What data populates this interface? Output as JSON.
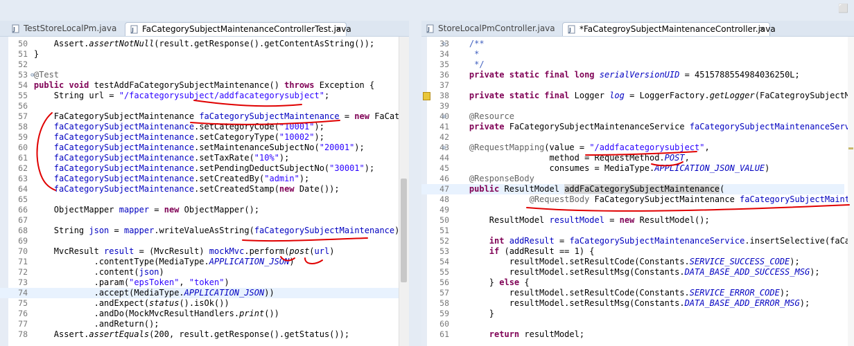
{
  "window": {
    "maximize_glyph": "⬜"
  },
  "left": {
    "tabs": [
      {
        "label": "TestStoreLocalPm.java",
        "active": false
      },
      {
        "label": "FaCategorySubjectMaintenanceControllerTest.java",
        "active": true,
        "close": "✕"
      }
    ],
    "lines": [
      {
        "n": "50",
        "t": [
          [
            "        Assert.",
            ""
          ],
          [
            "assertNotNull",
            "it"
          ],
          [
            "(result.getResponse().getContentAsString());",
            ""
          ]
        ]
      },
      {
        "n": "51",
        "t": [
          [
            "    }",
            ""
          ]
        ]
      },
      {
        "n": "52",
        "t": []
      },
      {
        "n": "53",
        "fold": "⊖",
        "t": [
          [
            "    @Test",
            "an"
          ]
        ]
      },
      {
        "n": "54",
        "t": [
          [
            "    ",
            ""
          ],
          [
            "public void",
            "kw"
          ],
          [
            " testAddFaCategorySubjectMaintenance() ",
            ""
          ],
          [
            "throws",
            "kw"
          ],
          [
            " Exception {",
            ""
          ]
        ]
      },
      {
        "n": "55",
        "t": [
          [
            "        String url = ",
            ""
          ],
          [
            "\"/facategorysubject/addfacategorysubject\"",
            "st"
          ],
          [
            ";",
            ""
          ]
        ]
      },
      {
        "n": "56",
        "t": []
      },
      {
        "n": "57",
        "t": [
          [
            "        FaCategorySubjectMaintenance ",
            ""
          ],
          [
            "faCategorySubjectMaintenance",
            "fn"
          ],
          [
            " = ",
            ""
          ],
          [
            "new",
            "kw"
          ],
          [
            " FaCategorySubjectMaintenance();",
            ""
          ]
        ]
      },
      {
        "n": "58",
        "t": [
          [
            "        ",
            ""
          ],
          [
            "faCategorySubjectMaintenance",
            "fn"
          ],
          [
            ".setCategoryCode(",
            ""
          ],
          [
            "\"10001\"",
            "st"
          ],
          [
            ");",
            ""
          ]
        ]
      },
      {
        "n": "59",
        "t": [
          [
            "        ",
            ""
          ],
          [
            "faCategorySubjectMaintenance",
            "fn"
          ],
          [
            ".setCategoryType(",
            ""
          ],
          [
            "\"10002\"",
            "st"
          ],
          [
            ");",
            ""
          ]
        ]
      },
      {
        "n": "60",
        "t": [
          [
            "        ",
            ""
          ],
          [
            "faCategorySubjectMaintenance",
            "fn"
          ],
          [
            ".setMaintenanceSubjectNo(",
            ""
          ],
          [
            "\"20001\"",
            "st"
          ],
          [
            ");",
            ""
          ]
        ]
      },
      {
        "n": "61",
        "t": [
          [
            "        ",
            ""
          ],
          [
            "faCategorySubjectMaintenance",
            "fn"
          ],
          [
            ".setTaxRate(",
            ""
          ],
          [
            "\"10%\"",
            "st"
          ],
          [
            ");",
            ""
          ]
        ]
      },
      {
        "n": "62",
        "t": [
          [
            "        ",
            ""
          ],
          [
            "faCategorySubjectMaintenance",
            "fn"
          ],
          [
            ".setPendingDeductSubjectNo(",
            ""
          ],
          [
            "\"30001\"",
            "st"
          ],
          [
            ");",
            ""
          ]
        ]
      },
      {
        "n": "63",
        "t": [
          [
            "        ",
            ""
          ],
          [
            "faCategorySubjectMaintenance",
            "fn"
          ],
          [
            ".setCreatedBy(",
            ""
          ],
          [
            "\"admin\"",
            "st"
          ],
          [
            ");",
            ""
          ]
        ]
      },
      {
        "n": "64",
        "t": [
          [
            "        ",
            ""
          ],
          [
            "faCategorySubjectMaintenance",
            "fn"
          ],
          [
            ".setCreatedStamp(",
            ""
          ],
          [
            "new",
            "kw"
          ],
          [
            " Date());",
            ""
          ]
        ]
      },
      {
        "n": "65",
        "t": []
      },
      {
        "n": "66",
        "t": [
          [
            "        ObjectMapper ",
            ""
          ],
          [
            "mapper",
            "fn"
          ],
          [
            " = ",
            ""
          ],
          [
            "new",
            "kw"
          ],
          [
            " ObjectMapper();",
            ""
          ]
        ]
      },
      {
        "n": "67",
        "t": []
      },
      {
        "n": "68",
        "t": [
          [
            "        String ",
            ""
          ],
          [
            "json",
            "fn"
          ],
          [
            " = ",
            ""
          ],
          [
            "mapper",
            "fn"
          ],
          [
            ".writeValueAsString(",
            ""
          ],
          [
            "faCategorySubjectMaintenance",
            "fn"
          ],
          [
            ");",
            ""
          ]
        ]
      },
      {
        "n": "69",
        "t": []
      },
      {
        "n": "70",
        "t": [
          [
            "        MvcResult ",
            ""
          ],
          [
            "result",
            "fn"
          ],
          [
            " = (MvcResult) ",
            ""
          ],
          [
            "mockMvc",
            "fn"
          ],
          [
            ".perform(",
            ""
          ],
          [
            "post",
            "it"
          ],
          [
            "(",
            ""
          ],
          [
            "url",
            "fn"
          ],
          [
            ")",
            ""
          ]
        ]
      },
      {
        "n": "71",
        "t": [
          [
            "                .contentType(MediaType.",
            ""
          ],
          [
            "APPLICATION_JSON",
            "fi"
          ],
          [
            ")",
            ""
          ]
        ]
      },
      {
        "n": "72",
        "t": [
          [
            "                .content(",
            ""
          ],
          [
            "json",
            "fn"
          ],
          [
            ")",
            ""
          ]
        ]
      },
      {
        "n": "73",
        "t": [
          [
            "                .param(",
            ""
          ],
          [
            "\"epsToken\"",
            "st"
          ],
          [
            ", ",
            ""
          ],
          [
            "\"token\"",
            "st"
          ],
          [
            ")",
            ""
          ]
        ]
      },
      {
        "n": "74",
        "hl": true,
        "t": [
          [
            "                .accept(MediaType.",
            ""
          ],
          [
            "APPLICATION_JSON",
            "fi"
          ],
          [
            "))",
            ""
          ]
        ]
      },
      {
        "n": "75",
        "t": [
          [
            "                .andExpect(",
            ""
          ],
          [
            "status",
            "it"
          ],
          [
            "().isOk())",
            ""
          ]
        ]
      },
      {
        "n": "76",
        "t": [
          [
            "                .andDo(MockMvcResultHandlers.",
            ""
          ],
          [
            "print",
            "it"
          ],
          [
            "())",
            ""
          ]
        ]
      },
      {
        "n": "77",
        "t": [
          [
            "                .andReturn();",
            ""
          ]
        ]
      },
      {
        "n": "78",
        "t": [
          [
            "        Assert.",
            ""
          ],
          [
            "assertEquals",
            "it"
          ],
          [
            "(200, result.getResponse().getStatus());",
            ""
          ]
        ]
      }
    ]
  },
  "right": {
    "tabs": [
      {
        "label": "StoreLocalPmController.java",
        "active": false
      },
      {
        "label": "*FaCategroySubjectMaintenanceController.java",
        "active": true,
        "close": "✕"
      }
    ],
    "lines": [
      {
        "n": "33",
        "fold": "⊖",
        "t": [
          [
            "    /**",
            "cm"
          ]
        ]
      },
      {
        "n": "34",
        "t": [
          [
            "     *",
            "cm"
          ]
        ]
      },
      {
        "n": "35",
        "t": [
          [
            "     */",
            "cm"
          ]
        ]
      },
      {
        "n": "36",
        "t": [
          [
            "    ",
            ""
          ],
          [
            "private static final long",
            "kw"
          ],
          [
            " ",
            ""
          ],
          [
            "serialVersionUID",
            "fi"
          ],
          [
            " = 4515788554984036250L;",
            ""
          ]
        ]
      },
      {
        "n": "37",
        "t": []
      },
      {
        "n": "38",
        "warn": true,
        "t": [
          [
            "    ",
            ""
          ],
          [
            "private static final",
            "kw"
          ],
          [
            " Logger ",
            ""
          ],
          [
            "log",
            "fi"
          ],
          [
            " = LoggerFactory.",
            ""
          ],
          [
            "getLogger",
            "it"
          ],
          [
            "(FaCategroySubjectMaintenanceController.class);",
            ""
          ]
        ]
      },
      {
        "n": "39",
        "t": []
      },
      {
        "n": "40",
        "fold": "⊖",
        "t": [
          [
            "    @Resource",
            "an"
          ]
        ]
      },
      {
        "n": "41",
        "t": [
          [
            "    ",
            ""
          ],
          [
            "private",
            "kw"
          ],
          [
            " FaCategorySubjectMaintenanceService ",
            ""
          ],
          [
            "faCategorySubjectMaintenanceService",
            "fn"
          ],
          [
            ";",
            ""
          ]
        ]
      },
      {
        "n": "42",
        "t": []
      },
      {
        "n": "43",
        "fold": "⊖",
        "t": [
          [
            "    @RequestMapping",
            "an"
          ],
          [
            "(value = ",
            ""
          ],
          [
            "\"/addfacategorysubject\"",
            "st"
          ],
          [
            ",",
            ""
          ]
        ]
      },
      {
        "n": "44",
        "t": [
          [
            "                    method = RequestMethod.",
            ""
          ],
          [
            "POST",
            "fi"
          ],
          [
            ",",
            ""
          ]
        ]
      },
      {
        "n": "45",
        "t": [
          [
            "                    consumes = MediaType.",
            ""
          ],
          [
            "APPLICATION_JSON_VALUE",
            "fi"
          ],
          [
            ")",
            ""
          ]
        ]
      },
      {
        "n": "46",
        "t": [
          [
            "    @ResponseBody",
            "an"
          ]
        ]
      },
      {
        "n": "47",
        "hl": true,
        "t": [
          [
            "    ",
            ""
          ],
          [
            "public",
            "kw"
          ],
          [
            " ResultModel ",
            ""
          ],
          [
            "addFaCategorySubjectMaintenance",
            "wordhl"
          ],
          [
            "(",
            ""
          ]
        ]
      },
      {
        "n": "48",
        "t": [
          [
            "                ",
            ""
          ],
          [
            "@RequestBody",
            "an"
          ],
          [
            " FaCategorySubjectMaintenance ",
            ""
          ],
          [
            "faCategorySubjectMaintenance",
            "fn"
          ],
          [
            ") {",
            ""
          ]
        ]
      },
      {
        "n": "49",
        "t": []
      },
      {
        "n": "50",
        "t": [
          [
            "        ResultModel ",
            ""
          ],
          [
            "resultModel",
            "fn"
          ],
          [
            " = ",
            ""
          ],
          [
            "new",
            "kw"
          ],
          [
            " ResultModel();",
            ""
          ]
        ]
      },
      {
        "n": "51",
        "t": []
      },
      {
        "n": "52",
        "t": [
          [
            "        ",
            ""
          ],
          [
            "int",
            "kw"
          ],
          [
            " ",
            ""
          ],
          [
            "addResult",
            "fn"
          ],
          [
            " = ",
            ""
          ],
          [
            "faCategorySubjectMaintenanceService",
            "fn"
          ],
          [
            ".insertSelective(faCategorySubjectMaintenance);",
            ""
          ]
        ]
      },
      {
        "n": "53",
        "t": [
          [
            "        ",
            ""
          ],
          [
            "if",
            "kw"
          ],
          [
            " (addResult == 1) {",
            ""
          ]
        ]
      },
      {
        "n": "54",
        "t": [
          [
            "            resultModel.setResultCode(Constants.",
            ""
          ],
          [
            "SERVICE_SUCCESS_CODE",
            "fi"
          ],
          [
            ");",
            ""
          ]
        ]
      },
      {
        "n": "55",
        "t": [
          [
            "            resultModel.setResultMsg(Constants.",
            ""
          ],
          [
            "DATA_BASE_ADD_SUCCESS_MSG",
            "fi"
          ],
          [
            ");",
            ""
          ]
        ]
      },
      {
        "n": "56",
        "t": [
          [
            "        } ",
            ""
          ],
          [
            "else",
            "kw"
          ],
          [
            " {",
            ""
          ]
        ]
      },
      {
        "n": "57",
        "t": [
          [
            "            resultModel.setResultCode(Constants.",
            ""
          ],
          [
            "SERVICE_ERROR_CODE",
            "fi"
          ],
          [
            ");",
            ""
          ]
        ]
      },
      {
        "n": "58",
        "t": [
          [
            "            resultModel.setResultMsg(Constants.",
            ""
          ],
          [
            "DATA_BASE_ADD_ERROR_MSG",
            "fi"
          ],
          [
            ");",
            ""
          ]
        ]
      },
      {
        "n": "59",
        "t": [
          [
            "        }",
            ""
          ]
        ]
      },
      {
        "n": "60",
        "t": []
      },
      {
        "n": "61",
        "t": [
          [
            "        ",
            ""
          ],
          [
            "return",
            "kw"
          ],
          [
            " resultModel;",
            ""
          ]
        ]
      }
    ]
  }
}
